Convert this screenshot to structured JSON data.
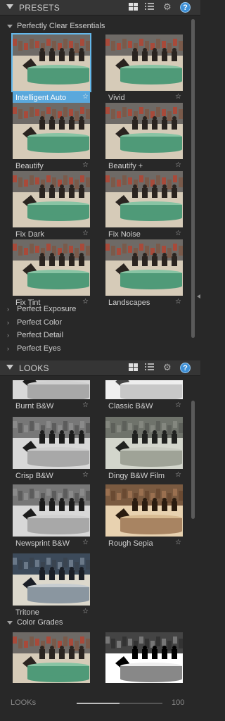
{
  "presets": {
    "title": "PRESETS",
    "expanded_group": "Perfectly Clear Essentials",
    "items": [
      {
        "label": "Intelligent Auto",
        "selected": true,
        "tone": "color"
      },
      {
        "label": "Vivid",
        "selected": false,
        "tone": "color"
      },
      {
        "label": "Beautify",
        "selected": false,
        "tone": "color"
      },
      {
        "label": "Beautify +",
        "selected": false,
        "tone": "color"
      },
      {
        "label": "Fix Dark",
        "selected": false,
        "tone": "color"
      },
      {
        "label": "Fix Noise",
        "selected": false,
        "tone": "color"
      },
      {
        "label": "Fix Tint",
        "selected": false,
        "tone": "color"
      },
      {
        "label": "Landscapes",
        "selected": false,
        "tone": "color"
      }
    ],
    "collapsed_groups": [
      "Perfect Exposure",
      "Perfect Color",
      "Perfect Detail",
      "Perfect Eyes"
    ]
  },
  "looks": {
    "title": "LOOKS",
    "items": [
      {
        "label": "Burnt B&W",
        "tone": "bw"
      },
      {
        "label": "Classic B&W",
        "tone": "bwlight"
      },
      {
        "label": "Crisp B&W",
        "tone": "bw"
      },
      {
        "label": "Dingy B&W Film",
        "tone": "bwdingy"
      },
      {
        "label": "Newsprint B&W",
        "tone": "bw"
      },
      {
        "label": "Rough Sepia",
        "tone": "sepia"
      },
      {
        "label": "Tritone",
        "tone": "tritone"
      }
    ],
    "expanded_group": "Color Grades",
    "grade_tones": [
      "color",
      "bwcontrast"
    ]
  },
  "footer": {
    "label": "LOOKs",
    "value": "100",
    "strength_fraction": 0.5
  },
  "icons": {
    "grid_view": "grid-view-icon",
    "list_view": "list-view-icon",
    "settings": "gear-icon",
    "help": "help-icon",
    "favorite": "star-icon"
  },
  "glyphs": {
    "star": "☆",
    "gear": "⚙",
    "help": "?",
    "chev_right": "›"
  },
  "colors": {
    "accent": "#5aa8dc",
    "panel_bg": "#282828",
    "header_bg": "#353535",
    "help_blue": "#3d8fd6"
  }
}
